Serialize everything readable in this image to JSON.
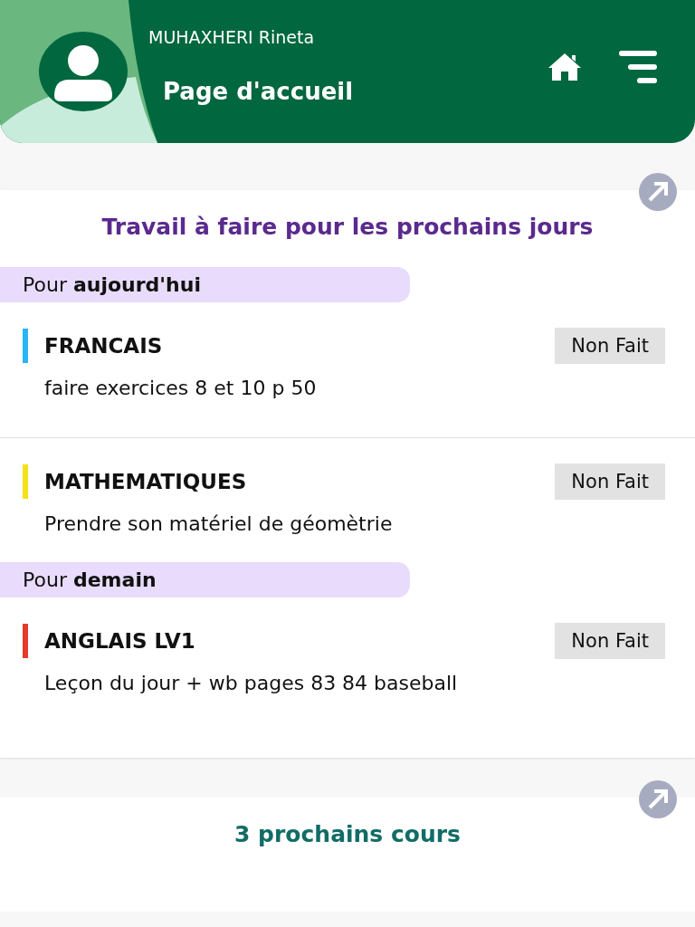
{
  "header": {
    "user_name": "MUHAXHERI Rineta",
    "page_title": "Page d'accueil"
  },
  "homework": {
    "title": "Travail à faire pour les prochains jours",
    "groups": [
      {
        "label": "Pour **aujourd'hui**",
        "tasks": [
          {
            "subject": "FRANCAIS",
            "color": "#29b6f6",
            "description": "faire exercices 8 et 10 p 50",
            "status": "Non Fait",
            "done": false
          },
          {
            "subject": "MATHEMATIQUES",
            "color": "#f5e11a",
            "description": "Prendre son matériel de géomètrie",
            "status": "Non Fait",
            "done": false
          }
        ]
      },
      {
        "label": "Pour **demain**",
        "tasks": [
          {
            "subject": "ANGLAIS LV1",
            "color": "#e53b2c",
            "description": "Leçon du jour + wb pages 83 84 baseball",
            "status": "Non Fait",
            "done": false
          }
        ]
      }
    ]
  },
  "next_classes": {
    "title": "3 prochains cours"
  }
}
